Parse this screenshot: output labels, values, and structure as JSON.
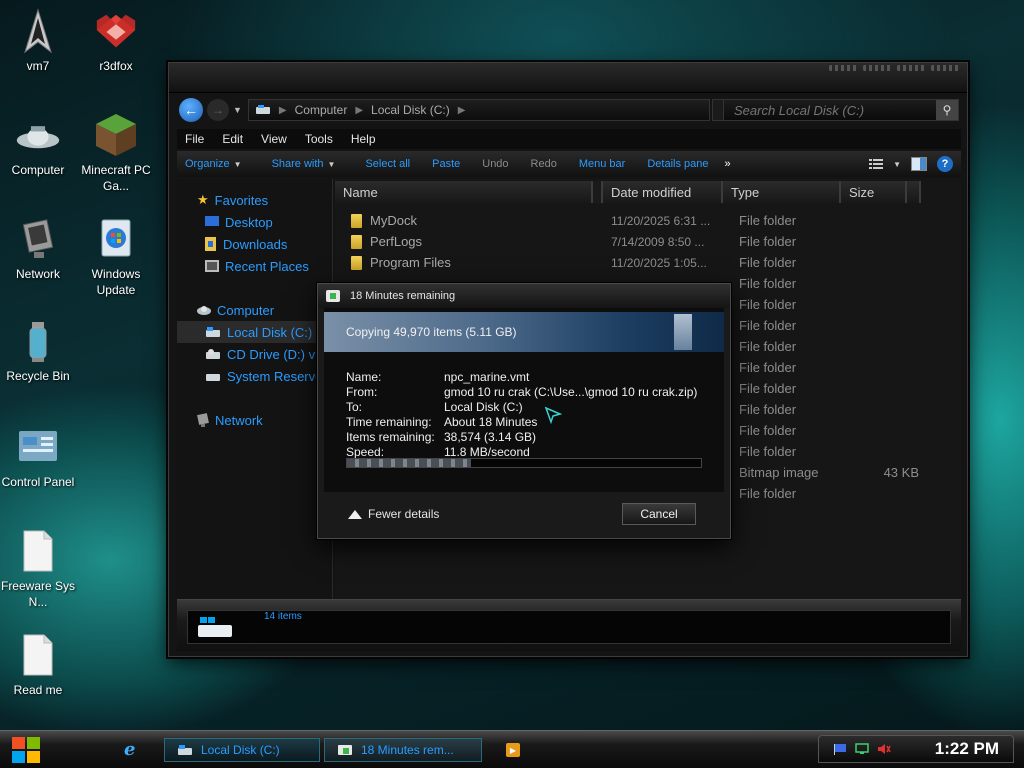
{
  "desktop": {
    "icons": [
      {
        "label": "vm7"
      },
      {
        "label": "r3dfox"
      },
      {
        "label": "Computer"
      },
      {
        "label": "Minecraft PC Ga..."
      },
      {
        "label": "Network"
      },
      {
        "label": "Windows Update"
      },
      {
        "label": "Recycle Bin"
      },
      {
        "label": "Control Panel"
      },
      {
        "label": "Freeware Sys N..."
      },
      {
        "label": "Read me"
      }
    ]
  },
  "explorer": {
    "breadcrumbs": [
      "Computer",
      "Local Disk (C:)"
    ],
    "search_placeholder": "Search Local Disk (C:)",
    "menu": [
      "File",
      "Edit",
      "View",
      "Tools",
      "Help"
    ],
    "toolbar": {
      "organize": "Organize",
      "share_with": "Share with",
      "select_all": "Select all",
      "paste": "Paste",
      "undo": "Undo",
      "redo": "Redo",
      "menu_bar": "Menu bar",
      "details_pane": "Details pane",
      "overflow": "»"
    },
    "nav": {
      "favorites": "Favorites",
      "desktop": "Desktop",
      "downloads": "Downloads",
      "recent_places": "Recent Places",
      "computer": "Computer",
      "local_disk": "Local Disk (C:)",
      "cd_drive": "CD Drive (D:) vir",
      "system_reserved": "System Reserve",
      "network": "Network"
    },
    "columns": {
      "name": "Name",
      "date": "Date modified",
      "type": "Type",
      "size": "Size"
    },
    "files": [
      {
        "name": "MyDock",
        "date": "11/20/2025 6:31 ...",
        "type": "File folder",
        "size": ""
      },
      {
        "name": "PerfLogs",
        "date": "7/14/2009 8:50 ...",
        "type": "File folder",
        "size": ""
      },
      {
        "name": "Program Files",
        "date": "11/20/2025 1:05...",
        "type": "File folder",
        "size": ""
      },
      {
        "name": "",
        "date": "",
        "type": "File folder",
        "size": ""
      },
      {
        "name": "",
        "date": "",
        "type": "File folder",
        "size": ""
      },
      {
        "name": "",
        "date": "",
        "type": "File folder",
        "size": ""
      },
      {
        "name": "",
        "date": "",
        "type": "File folder",
        "size": ""
      },
      {
        "name": "",
        "date": "",
        "type": "File folder",
        "size": ""
      },
      {
        "name": "",
        "date": "",
        "type": "File folder",
        "size": ""
      },
      {
        "name": "",
        "date": "",
        "type": "File folder",
        "size": ""
      },
      {
        "name": "",
        "date": "",
        "type": "File folder",
        "size": ""
      },
      {
        "name": "",
        "date": "",
        "type": "File folder",
        "size": ""
      },
      {
        "name": "",
        "date": "",
        "type": "Bitmap image",
        "size": "43 KB"
      },
      {
        "name": "",
        "date": "",
        "type": "File folder",
        "size": ""
      }
    ],
    "status": {
      "item_count": "14 items"
    }
  },
  "copy_dialog": {
    "title": "18 Minutes remaining",
    "banner": "Copying 49,970 items (5.11 GB)",
    "fields": [
      {
        "label": "Name:",
        "value": "npc_marine.vmt"
      },
      {
        "label": "From:",
        "value": "gmod 10 ru crak (C:\\Use...\\gmod 10 ru crak.zip)"
      },
      {
        "label": "To:",
        "value": "Local Disk (C:)"
      },
      {
        "label": "Time remaining:",
        "value": "About 18 Minutes"
      },
      {
        "label": "Items remaining:",
        "value": "38,574 (3.14 GB)"
      },
      {
        "label": "Speed:",
        "value": "11.8 MB/second"
      }
    ],
    "progress_fraction": 0.35,
    "fewer_details": "Fewer details",
    "cancel": "Cancel"
  },
  "taskbar": {
    "ie_glyph": "e",
    "tasks": [
      {
        "label": "Local Disk (C:)"
      },
      {
        "label": "18 Minutes rem..."
      }
    ],
    "clock": "1:22 PM"
  },
  "colors": {
    "accent_blue": "#2b9cff",
    "window_bg": "#141414",
    "folder_yellow": "#f3d15a",
    "teal_bg": "#1ea6a0"
  }
}
